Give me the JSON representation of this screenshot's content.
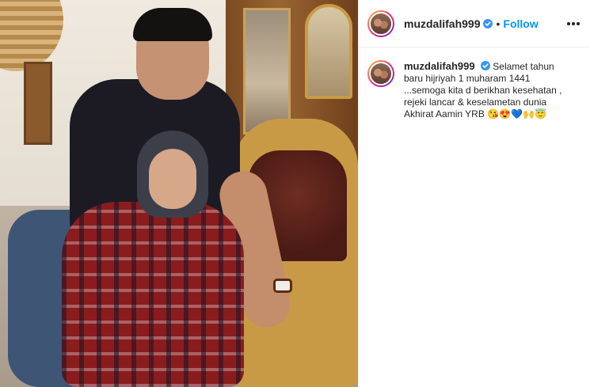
{
  "post": {
    "username": "muzdalifah999",
    "separator": "•",
    "follow_label": "Follow",
    "verified_icon": "verified-badge-icon",
    "more_icon": "more-options-icon",
    "caption": "Selamet tahun baru hijriyah 1 muharam 1441 ...semoga kita d berikhan kesehatan , rejeki lancar & keselametan dunia Akhirat Aamin YRB",
    "caption_emojis": "😘😍💙🙌😇"
  },
  "colors": {
    "follow": "#0095f6",
    "verified": "#3897f0",
    "text": "#262626",
    "border": "#efefef"
  }
}
